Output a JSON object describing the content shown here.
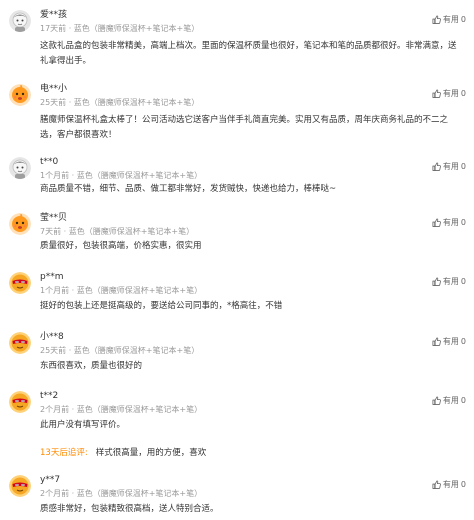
{
  "reviews": [
    {
      "username": "爱**孩",
      "meta": "17天前 · 蓝色（膳魔师保温杯+笔记本+笔）",
      "helpful_label": "有用",
      "helpful_count": "0",
      "avatar": "gray-child-avatar",
      "content": "这款礼品盒的包装非常精美，高端上档次。里面的保温杯质量也很好，笔记本和笔的品质都很好。非常满意，送礼拿得出手。"
    },
    {
      "username": "电**小",
      "meta": "25天前 · 蓝色（膳魔师保温杯+笔记本+笔）",
      "helpful_label": "有用",
      "helpful_count": "0",
      "avatar": "orange-baby-avatar",
      "content": "膳魔师保温杯礼盒太棒了！公司活动选它送客户当伴手礼简直完美。实用又有品质，周年庆商务礼品的不二之选，客户都很喜欢！"
    },
    {
      "username": "t**0",
      "meta": "1个月前 · 蓝色（膳魔师保温杯+笔记本+笔）",
      "helpful_label": "有用",
      "helpful_count": "0",
      "avatar": "gray-child-avatar",
      "content": "商品质量不错，细节、品质、做工都非常好，发货贼快，快递也给力，棒棒哒~"
    },
    {
      "username": "莹**贝",
      "meta": "7天前 · 蓝色（膳魔师保温杯+笔记本+笔）",
      "helpful_label": "有用",
      "helpful_count": "0",
      "avatar": "orange-baby-avatar",
      "content": "质量很好，包装很高端，价格实惠，很实用"
    },
    {
      "username": "p**m",
      "meta": "1个月前 · 蓝色（膳魔师保温杯+笔记本+笔）",
      "helpful_label": "有用",
      "helpful_count": "0",
      "avatar": "red-mask-avatar",
      "content": "挺好的包装上还是挺高级的，要送给公司同事的，*格高往，不错"
    },
    {
      "username": "小**8",
      "meta": "25天前 · 蓝色（膳魔师保温杯+笔记本+笔）",
      "helpful_label": "有用",
      "helpful_count": "0",
      "avatar": "red-mask-avatar",
      "content": "东西很喜欢，质量也很好的"
    },
    {
      "username": "t**2",
      "meta": "2个月前 · 蓝色（膳魔师保温杯+笔记本+笔）",
      "helpful_label": "有用",
      "helpful_count": "0",
      "avatar": "red-mask-avatar",
      "content": "此用户没有填写评价。",
      "followup_label": "13天后追评:",
      "followup_text": "样式很高量，用的方便，喜欢"
    },
    {
      "username": "y**7",
      "meta": "2个月前 · 蓝色（膳魔师保温杯+笔记本+笔）",
      "helpful_label": "有用",
      "helpful_count": "0",
      "avatar": "red-mask-avatar",
      "content": "质感非常好，包装精致很高档，送人特别合适。"
    }
  ],
  "colors": {
    "accent": "#ff8a00",
    "meta_text": "#999999",
    "body_text": "#333333"
  }
}
